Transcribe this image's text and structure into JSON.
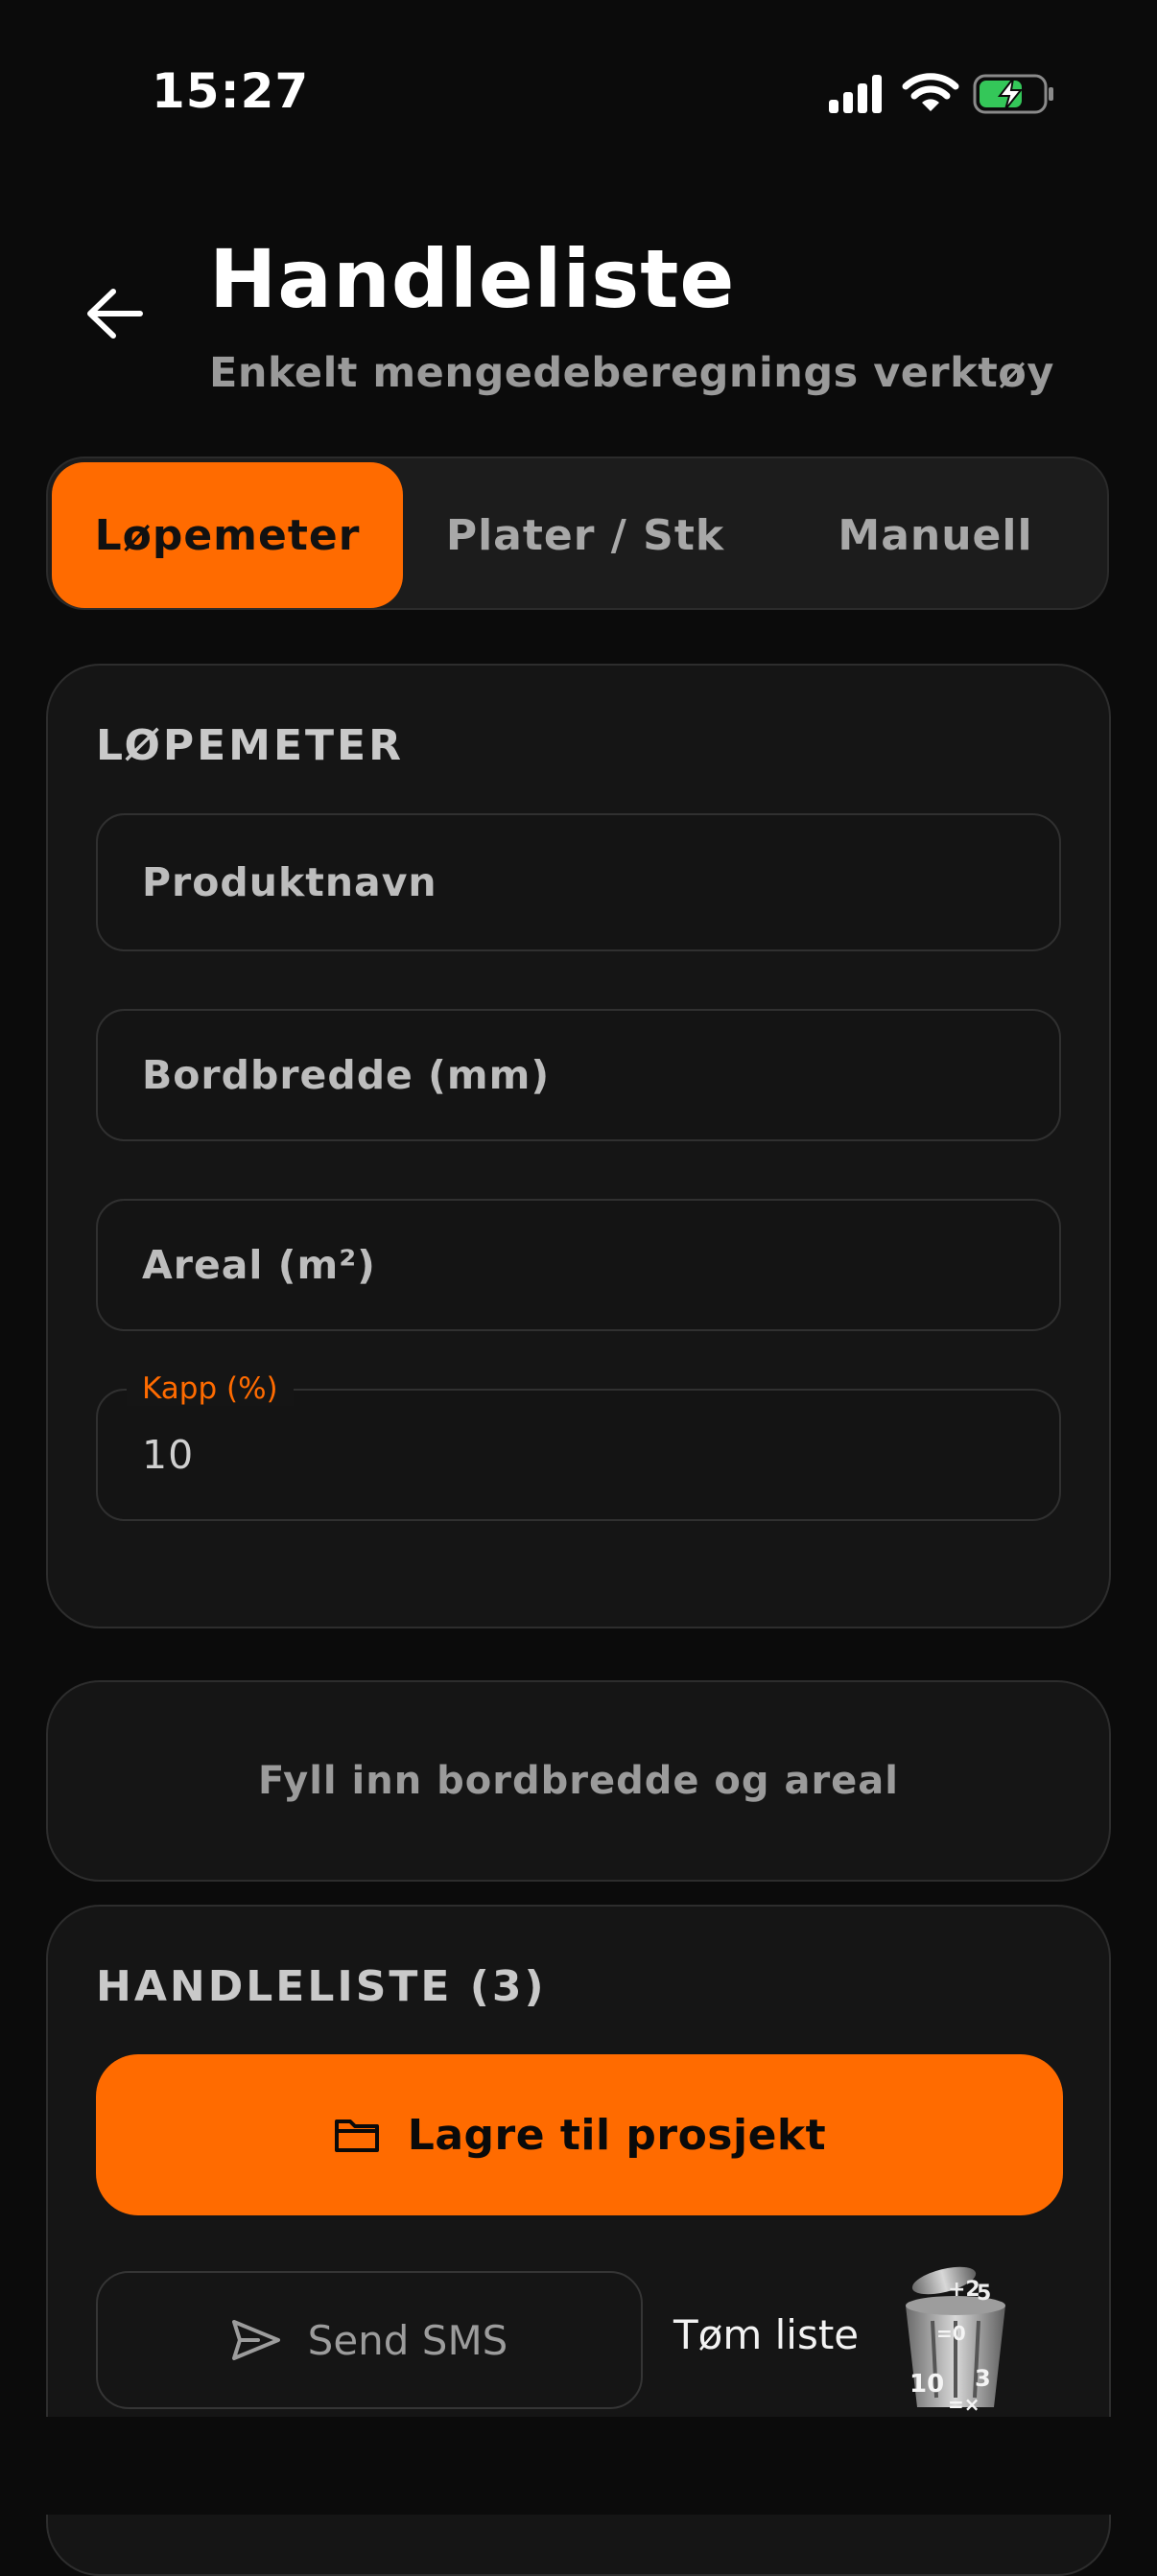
{
  "status_bar": {
    "time": "15:27",
    "icons": [
      "signal-icon",
      "wifi-icon",
      "battery-charging-icon"
    ]
  },
  "header": {
    "title": "Handleliste",
    "subtitle": "Enkelt mengedeberegnings verktøy",
    "back_icon": "arrow-left-icon"
  },
  "tabs": [
    {
      "label": "Løpemeter",
      "active": true
    },
    {
      "label": "Plater / Stk",
      "active": false
    },
    {
      "label": "Manuell",
      "active": false
    }
  ],
  "form": {
    "section_title": "LØPEMETER",
    "product_name_placeholder": "Produktnavn",
    "board_width_placeholder": "Bordbredde (mm)",
    "area_placeholder": "Areal (m²)",
    "waste_label": "Kapp (%)",
    "waste_value": "10"
  },
  "result": {
    "hint": "Fyll inn bordbredde og areal"
  },
  "shopping_list": {
    "title": "HANDLELISTE (3)",
    "save_button": "Lagre til prosjekt",
    "save_icon": "folder-icon",
    "sms_button": "Send SMS",
    "sms_icon": "send-icon",
    "clear_label": "Tøm liste",
    "clear_icon": "trash-can-icon"
  },
  "colors": {
    "accent": "#ff6b00",
    "background": "#0b0b0b",
    "card": "#151515",
    "muted_text": "#9b9b9b"
  }
}
